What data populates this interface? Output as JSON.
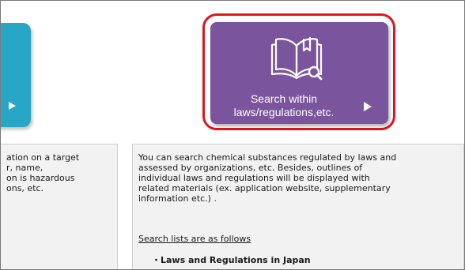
{
  "left_tile": {
    "arrow_icon": "play-arrow-icon"
  },
  "search_tile": {
    "icon": "book-search-icon",
    "label_line1": "Search within",
    "label_line2": "laws/regulations,etc.",
    "arrow_icon": "play-arrow-icon",
    "background": "#7a559e",
    "highlight_color": "#e2141b"
  },
  "left_panel": {
    "lines": [
      "ation on a target",
      "r, name,",
      "on is hazardous",
      "ons, etc."
    ]
  },
  "right_panel": {
    "lines": [
      "You can search chemical substances regulated by laws and",
      "assessed by organizations, etc. Besides, outlines of",
      "individual laws and regulations will be displayed with",
      "related materials (ex. application website, supplementary",
      "information etc.) ."
    ],
    "lists_link": "Search lists are as follows",
    "list_items": [
      "・Laws and Regulations in Japan"
    ]
  },
  "colors": {
    "teal_tile": "#27a6c5",
    "panel_bg": "#f2f2f2"
  }
}
